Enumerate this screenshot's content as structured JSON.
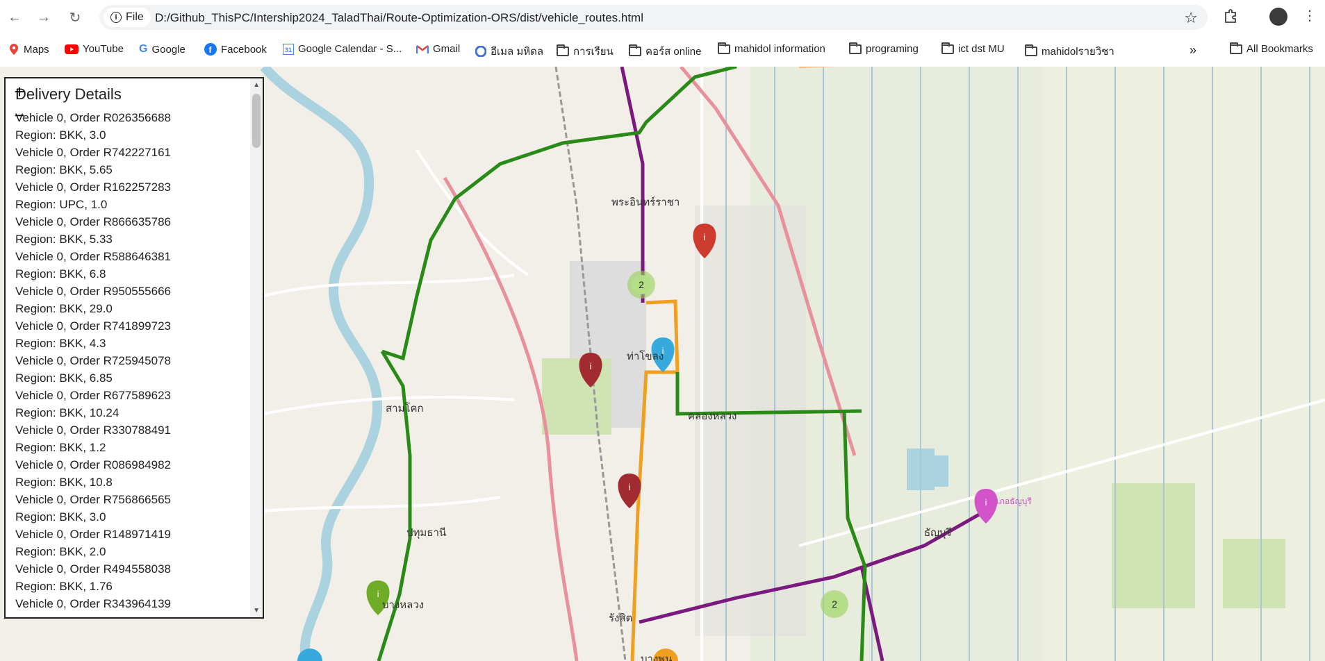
{
  "browser": {
    "file_label": "File",
    "url": "D:/Github_ThisPC/Intership2024_TaladThai/Route-Optimization-ORS/dist/vehicle_routes.html",
    "bookmarks": [
      {
        "label": "Maps",
        "icon": "maps-icon"
      },
      {
        "label": "YouTube",
        "icon": "youtube-icon"
      },
      {
        "label": "Google",
        "icon": "google-icon"
      },
      {
        "label": "Facebook",
        "icon": "facebook-icon"
      },
      {
        "label": "Google Calendar - S...",
        "icon": "calendar-icon"
      },
      {
        "label": "Gmail",
        "icon": "gmail-icon"
      },
      {
        "label": "อีเมล มหิดล",
        "icon": "mahidol-mail-icon"
      },
      {
        "label": "การเรียน",
        "icon": "folder-icon"
      },
      {
        "label": "คอร์ส online",
        "icon": "folder-icon"
      },
      {
        "label": "mahidol information",
        "icon": "folder-icon"
      },
      {
        "label": "programing",
        "icon": "folder-icon"
      },
      {
        "label": "ict dst MU",
        "icon": "folder-icon"
      },
      {
        "label": "mahidolรายวิชา",
        "icon": "folder-icon"
      }
    ],
    "overflow_label": "»",
    "all_bookmarks": "All Bookmarks"
  },
  "map": {
    "zoom_in": "+",
    "zoom_out": "−",
    "cluster_counts": [
      "2",
      "2"
    ],
    "colors": {
      "route_green": "#2a8a17",
      "route_purple": "#7a1a7e",
      "route_orange": "#f0a020",
      "marker_red": "#cc3b2e",
      "marker_darkred": "#a12b30",
      "marker_blue": "#38a9dc",
      "marker_green": "#6fac25",
      "marker_pink": "#d254c8",
      "cluster": "#9ad05a"
    },
    "place_labels": [
      "สามโคก",
      "ปทุมธานี",
      "บางหลวง",
      "รังสิต",
      "ธัญบุรี",
      "พระอินทร์ราชา",
      "ท่าโขลง",
      "คลองหลวง",
      "บางพูน",
      "อำเภอธัญบุรี"
    ]
  },
  "panel": {
    "title": "Delivery Details",
    "lines": [
      "Vehicle 0, Order R026356688",
      "Region: BKK, 3.0",
      "Vehicle 0, Order R742227161",
      "Region: BKK, 5.65",
      "Vehicle 0, Order R162257283",
      "Region: UPC, 1.0",
      "Vehicle 0, Order R866635786",
      "Region: BKK, 5.33",
      "Vehicle 0, Order R588646381",
      "Region: BKK, 6.8",
      "Vehicle 0, Order R950555666",
      "Region: BKK, 29.0",
      "Vehicle 0, Order R741899723",
      "Region: BKK, 4.3",
      "Vehicle 0, Order R725945078",
      "Region: BKK, 6.85",
      "Vehicle 0, Order R677589623",
      "Region: BKK, 10.24",
      "Vehicle 0, Order R330788491",
      "Region: BKK, 1.2",
      "Vehicle 0, Order R086984982",
      "Region: BKK, 10.8",
      "Vehicle 0, Order R756866565",
      "Region: BKK, 3.0",
      "Vehicle 0, Order R148971419",
      "Region: BKK, 2.0",
      "Vehicle 0, Order R494558038",
      "Region: BKK, 1.76",
      "Vehicle 0, Order R343964139"
    ]
  }
}
